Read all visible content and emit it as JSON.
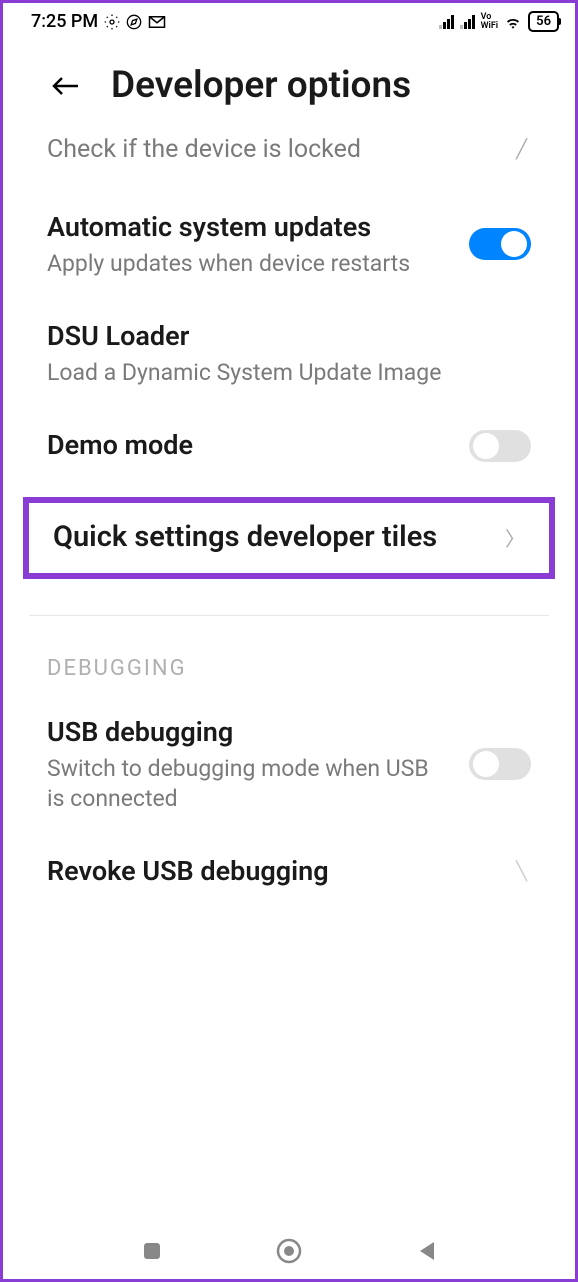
{
  "status_bar": {
    "time": "7:25 PM",
    "battery": "56"
  },
  "header": {
    "title": "Developer options"
  },
  "check_locked": {
    "text": "Check if the device is locked"
  },
  "items": {
    "auto_updates": {
      "title": "Automatic system updates",
      "subtitle": "Apply updates when device restarts"
    },
    "dsu": {
      "title": "DSU Loader",
      "subtitle": "Load a Dynamic System Update Image"
    },
    "demo": {
      "title": "Demo mode"
    },
    "quick_tiles": {
      "title": "Quick settings developer tiles"
    },
    "usb_debug": {
      "title": "USB debugging",
      "subtitle": "Switch to debugging mode when USB is connected"
    },
    "revoke_usb": {
      "title": "Revoke USB debugging"
    }
  },
  "sections": {
    "debugging": "DEBUGGING"
  }
}
